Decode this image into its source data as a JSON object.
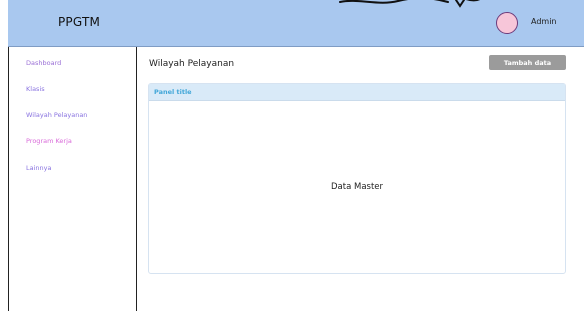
{
  "header": {
    "brand": "PPGTM",
    "user_name": "Admin",
    "colors": {
      "bar": "#a9c8ef",
      "avatar": "#f7c6d9",
      "avatar_border": "#6d3b7a"
    }
  },
  "sidebar": {
    "items": [
      {
        "label": "Dashboard",
        "color": "#9a6fd6"
      },
      {
        "label": "Klasis",
        "color": "#8a74e0"
      },
      {
        "label": "Wilayah Pelayanan",
        "color": "#8a74e0"
      },
      {
        "label": "Program Kerja",
        "color": "#d96ad9"
      },
      {
        "label": "Lainnya",
        "color": "#8a74e0"
      }
    ]
  },
  "main": {
    "title": "Wilayah Pelayanan",
    "add_button": "Tambah data",
    "panel": {
      "title": "Panel title",
      "body_text": "Data Master"
    }
  }
}
